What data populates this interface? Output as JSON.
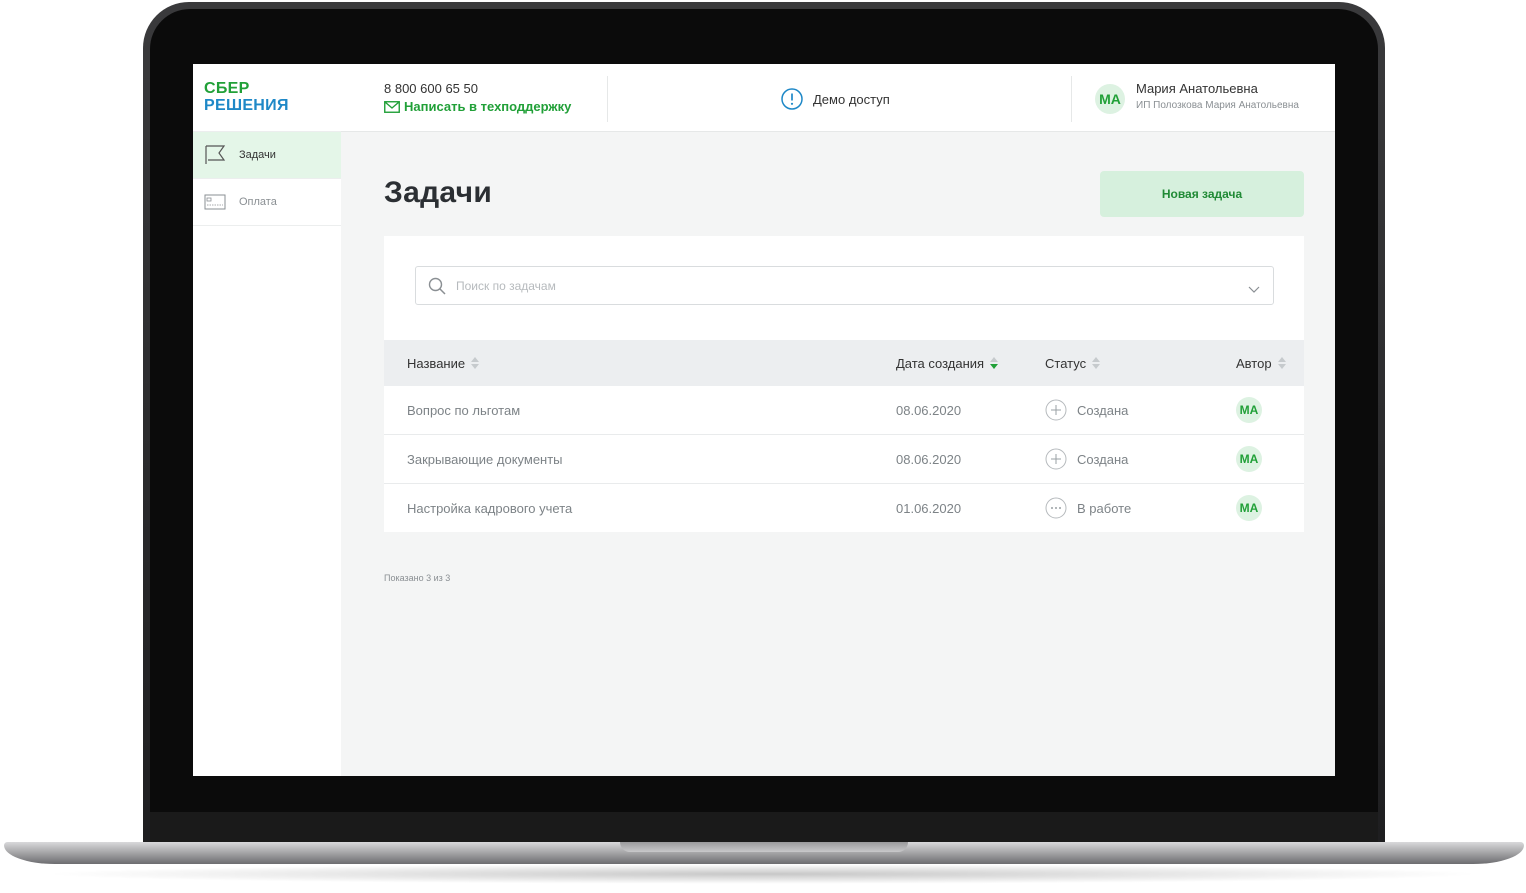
{
  "logo": {
    "line1": "СБЕР",
    "line2": "РЕШЕНИЯ"
  },
  "sidebar": {
    "items": [
      {
        "label": "Задачи",
        "icon": "flag-icon",
        "active": true
      },
      {
        "label": "Оплата",
        "icon": "card-icon",
        "active": false
      }
    ]
  },
  "header": {
    "phone": "8 800 600 65 50",
    "support_link": "Написать в техподдержку",
    "demo_label": "Демо доступ",
    "user": {
      "initials": "МА",
      "name": "Мария Анатольевна",
      "company": "ИП Полозкова Мария Анатольевна"
    }
  },
  "main": {
    "title": "Задачи",
    "new_task_label": "Новая задача",
    "search": {
      "placeholder": "Поиск по задачам",
      "value": ""
    },
    "columns": {
      "name": "Название",
      "date": "Дата создания",
      "status": "Статус",
      "author": "Автор"
    },
    "rows": [
      {
        "name": "Вопрос по льготам",
        "date": "08.06.2020",
        "status": "Создана",
        "status_icon": "plus-circle-icon",
        "author": "МА"
      },
      {
        "name": "Закрывающие документы",
        "date": "08.06.2020",
        "status": "Создана",
        "status_icon": "plus-circle-icon",
        "author": "МА"
      },
      {
        "name": "Настройка кадрового учета",
        "date": "01.06.2020",
        "status": "В работе",
        "status_icon": "dots-circle-icon",
        "author": "МА"
      }
    ],
    "shown_text": "Показано 3 из 3"
  },
  "colors": {
    "brand_green": "#21a038",
    "brand_blue": "#1e88c7",
    "active_bg": "#e4f6e8",
    "button_bg": "#d6f0dd"
  }
}
